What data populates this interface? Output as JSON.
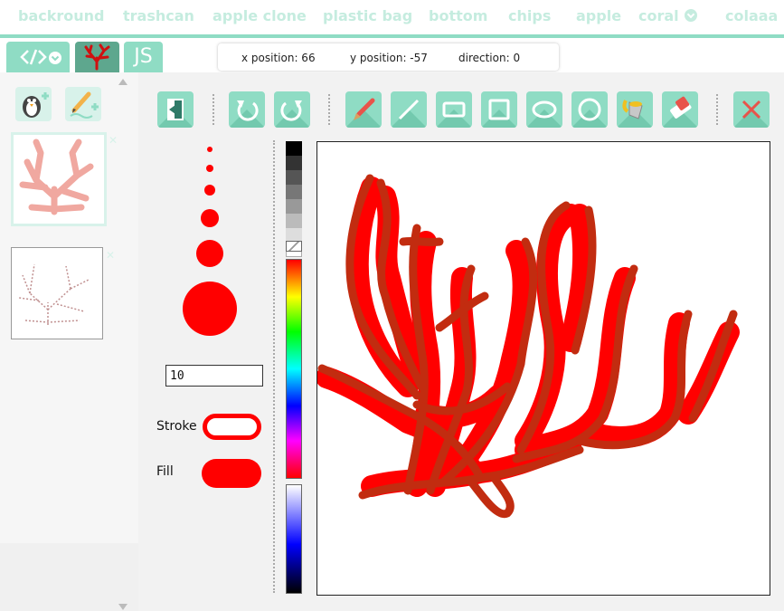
{
  "sprite_tabs": [
    "backround",
    "trashcan",
    "apple clone",
    "plastic bag",
    "bottom",
    "chips",
    "apple",
    "coral",
    "colaaa"
  ],
  "editor_tabs": {
    "js_label": "JS"
  },
  "readout": {
    "x_label": "x position: 66",
    "y_label": "y position: -57",
    "dir_label": "direction: 0"
  },
  "costumes": {
    "count": 2,
    "selected": 0
  },
  "tools": [
    "exit-editor",
    "undo",
    "redo",
    "brush",
    "line",
    "rectangle",
    "filled-square",
    "ellipse",
    "circle",
    "paint-bucket",
    "eraser",
    "close"
  ],
  "brush": {
    "size_value": "10",
    "stroke_label": "Stroke",
    "fill_label": "Fill",
    "stroke_color": "#ff0000",
    "fill_color": "#ff0000"
  },
  "colors": {
    "accent": "#8fdcc4",
    "accent_dark": "#5ea78e",
    "paint_red": "#ff0000",
    "paint_dark": "#c22c10"
  }
}
